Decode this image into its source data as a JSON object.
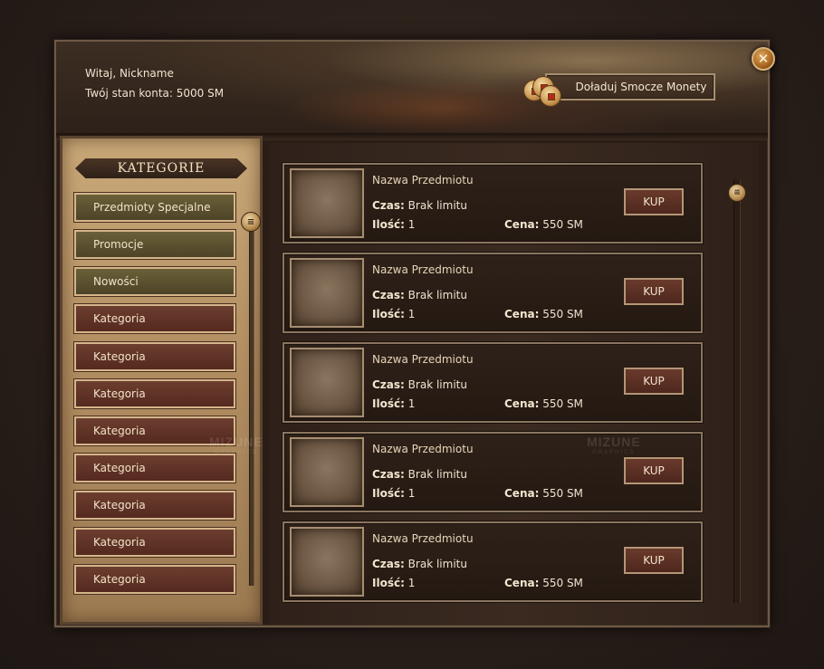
{
  "header": {
    "welcome": "Witaj, Nickname",
    "balance": "Twój stan konta: 5000 SM",
    "topup_label": "Doładuj Smocze Monety",
    "close_glyph": "✕"
  },
  "watermark": {
    "brand": "MIZUNE",
    "sub": "GRAPHICS"
  },
  "sidebar": {
    "title": "KATEGORIE",
    "items": [
      {
        "label": "Przedmioty Specjalne",
        "style": "green"
      },
      {
        "label": "Promocje",
        "style": "green"
      },
      {
        "label": "Nowości",
        "style": "green"
      },
      {
        "label": "Kategoria",
        "style": "red"
      },
      {
        "label": "Kategoria",
        "style": "red"
      },
      {
        "label": "Kategoria",
        "style": "red"
      },
      {
        "label": "Kategoria",
        "style": "red"
      },
      {
        "label": "Kategoria",
        "style": "red"
      },
      {
        "label": "Kategoria",
        "style": "red"
      },
      {
        "label": "Kategoria",
        "style": "red"
      },
      {
        "label": "Kategoria",
        "style": "red"
      }
    ],
    "scroll_glyph": "≡"
  },
  "shop": {
    "time_label": "Czas:",
    "qty_label": "Ilość:",
    "price_label": "Cena:",
    "buy_label": "KUP",
    "scroll_glyph": "≡",
    "items": [
      {
        "name": "Nazwa Przedmiotu",
        "time": "Brak limitu",
        "qty": "1",
        "price": "550 SM"
      },
      {
        "name": "Nazwa Przedmiotu",
        "time": "Brak limitu",
        "qty": "1",
        "price": "550 SM"
      },
      {
        "name": "Nazwa Przedmiotu",
        "time": "Brak limitu",
        "qty": "1",
        "price": "550 SM"
      },
      {
        "name": "Nazwa Przedmiotu",
        "time": "Brak limitu",
        "qty": "1",
        "price": "550 SM"
      },
      {
        "name": "Nazwa Przedmiotu",
        "time": "Brak limitu",
        "qty": "1",
        "price": "550 SM"
      }
    ]
  }
}
